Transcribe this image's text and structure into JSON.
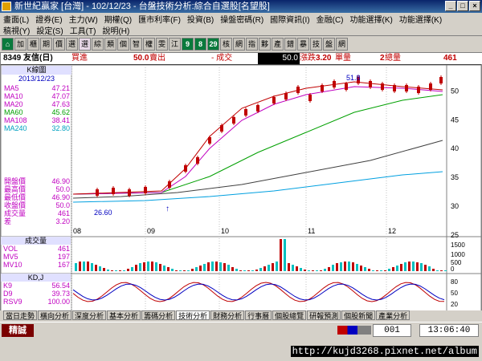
{
  "window": {
    "title": "新世紀贏家 [台灣] - 102/12/23 - 台盤技術分析:綜合自選股[名望股]"
  },
  "menu": {
    "row1": [
      "畫面(L)",
      "證券(E)",
      "主力(W)",
      "期權(Q)",
      "匯市利率(F)",
      "投資(B)",
      "操盤密碼(R)",
      "國際資訊(I)",
      "金融(C)",
      "功能選擇(K)",
      "功能選擇(K)"
    ],
    "row2": [
      "稿視(Y)",
      "設定(S)",
      "工具(T)",
      "說明(H)"
    ]
  },
  "toolbar": {
    "buttons": [
      "加",
      "櫃",
      "期",
      "價",
      "選",
      "選",
      "綜",
      "類",
      "個",
      "智",
      "權",
      "雯",
      "江",
      "9",
      "8",
      "29",
      "核",
      "網",
      "指",
      "夥",
      "產",
      "錯",
      "暴",
      "技",
      "盤",
      "網"
    ]
  },
  "info": {
    "code": "8349 友信(日)",
    "bid_label": "買進",
    "bid": "50.0",
    "ask_label": "賣出",
    "trade_label": "- 成交",
    "price": "50.0",
    "chg_label": "漲跌",
    "chg": "3.20",
    "vol_label": "單量",
    "vol": "2",
    "total_label": "總量",
    "total": "461"
  },
  "sidepanel": {
    "kline_label": "K線圖",
    "date": "2013/12/23",
    "ma": [
      {
        "name": "MA5",
        "value": "47.21"
      },
      {
        "name": "MA10",
        "value": "47.07"
      },
      {
        "name": "MA20",
        "value": "47.63"
      },
      {
        "name": "MA60",
        "value": "45.62"
      },
      {
        "name": "MA108",
        "value": "38.41"
      },
      {
        "name": "MA240",
        "value": "32.80"
      }
    ],
    "prices": [
      {
        "name": "開盤價",
        "value": "46.90"
      },
      {
        "name": "最高價",
        "value": "50.0"
      },
      {
        "name": "最低價",
        "value": "46.90"
      },
      {
        "name": "收盤價",
        "value": "50.0"
      },
      {
        "name": "成交量",
        "value": "461"
      },
      {
        "name": "差",
        "value": "3.20"
      }
    ],
    "vol_label": "成交量",
    "vols": [
      {
        "name": "VOL",
        "value": "461"
      },
      {
        "name": "MV5",
        "value": "197"
      },
      {
        "name": "MV10",
        "value": "167"
      }
    ],
    "kd_label": "KD,J",
    "kd": [
      {
        "name": "K9",
        "value": "56.54"
      },
      {
        "name": "D9",
        "value": "39.73"
      },
      {
        "name": "RSV9",
        "value": "100.00"
      }
    ]
  },
  "chart": {
    "high_label": "51.8",
    "low_label": "26.60",
    "xticks": [
      "08",
      "09",
      "10",
      "11",
      "12"
    ],
    "price_yticks": [
      "50",
      "45",
      "40",
      "35",
      "30",
      "25"
    ],
    "vol_yticks": [
      "1500",
      "1000",
      "500",
      "0"
    ],
    "kd_yticks": [
      "80",
      "50",
      "20"
    ]
  },
  "tabs": [
    "當日走勢",
    "橫向分析",
    "深度分析",
    "基本分析",
    "籌碼分析",
    "技術分析",
    "財務分析",
    "行事曆",
    "個股總覽",
    "研報預測",
    "個股新聞",
    "產業分析"
  ],
  "active_tab": "技術分析",
  "status": {
    "button": "精誠",
    "page": "001",
    "time": "13:06:40",
    "url": "http://kujd3268.pixnet.net/album"
  }
}
